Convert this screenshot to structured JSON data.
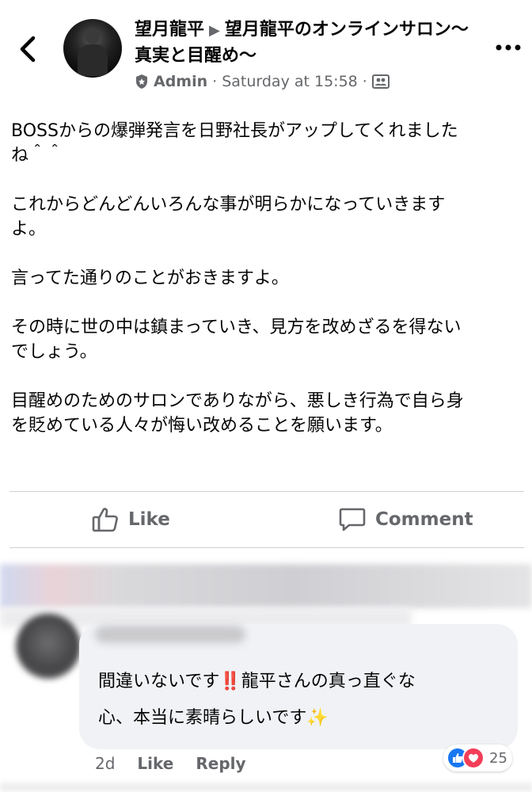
{
  "header": {
    "author": "望月龍平",
    "arrow": "▶",
    "group": "望月龍平のオンラインサロン〜真実と目醒め〜",
    "role": "Admin",
    "timestamp": "Saturday at 15:58",
    "separator": "·",
    "icons": {
      "back": "chevron-left-icon",
      "role": "shield-icon",
      "audience": "group-members-icon",
      "more": "more-dots-icon"
    }
  },
  "post": {
    "paragraphs": [
      "BOSSからの爆弾発言を日野社長がアップしてくれました\nね＾＾",
      "これからどんどんいろんな事が明らかになっていきます\nよ。",
      "言ってた通りのことがおきますよ。",
      "その時に世の中は鎮まっていき、見方を改めざるを得ない\nでしょう。",
      "目醒めのためのサロンでありながら、悪しき行為で自ら身\nを貶めている人々が悔い改めることを願います。"
    ]
  },
  "actions": {
    "like": "Like",
    "comment": "Comment"
  },
  "comment": {
    "text_part1": "間違いないです",
    "emoji1": "‼️",
    "text_part2": "龍平さんの真っ直ぐな\n心、本当に素晴らしいです",
    "emoji2": "✨",
    "age": "2d",
    "like": "Like",
    "reply": "Reply",
    "reaction_count": "25"
  },
  "colors": {
    "text": "#050505",
    "secondary": "#65676b",
    "bubble": "#f0f2f5",
    "like": "#1877f2",
    "love": "#f33e58"
  }
}
